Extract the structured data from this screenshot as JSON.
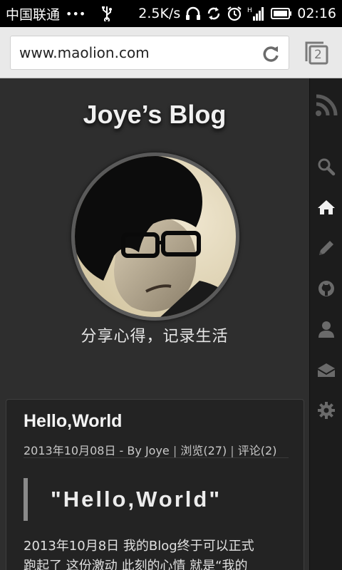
{
  "status_bar": {
    "carrier": "中国联通",
    "dots": "•••",
    "speed": "2.5K/s",
    "time": "02:16",
    "icons": [
      "usb-icon",
      "headphones-icon",
      "sync-icon",
      "alarm-icon",
      "signal-icon",
      "battery-icon"
    ]
  },
  "browser": {
    "url": "www.maolion.com",
    "tab_count": "2"
  },
  "page": {
    "blog_title": "Joye’s Blog",
    "tagline": "分享心得，记录生活"
  },
  "post": {
    "title": "Hello,World",
    "meta_date": "2013年10月08日",
    "meta_author": "- By Joye",
    "meta_views": "浏览(27)",
    "meta_comments": "评论(2)",
    "meta_separator": "|",
    "quote": "\"Hello,World\"",
    "body_line1": "2013年10月8日 我的Blog终于可以正式",
    "body_line2": "跑起了 这份激动 此刻的心情 就是“我的"
  },
  "sidebar": {
    "items": [
      "rss-icon",
      "search-icon",
      "home-icon",
      "edit-icon",
      "github-icon",
      "user-icon",
      "mail-icon",
      "settings-icon"
    ]
  },
  "colors": {
    "background": "#2e2e2e",
    "sidebar": "#1c1c1c",
    "card": "#232323",
    "status_bar": "#000000",
    "url_bar": "#e9e9e9"
  }
}
